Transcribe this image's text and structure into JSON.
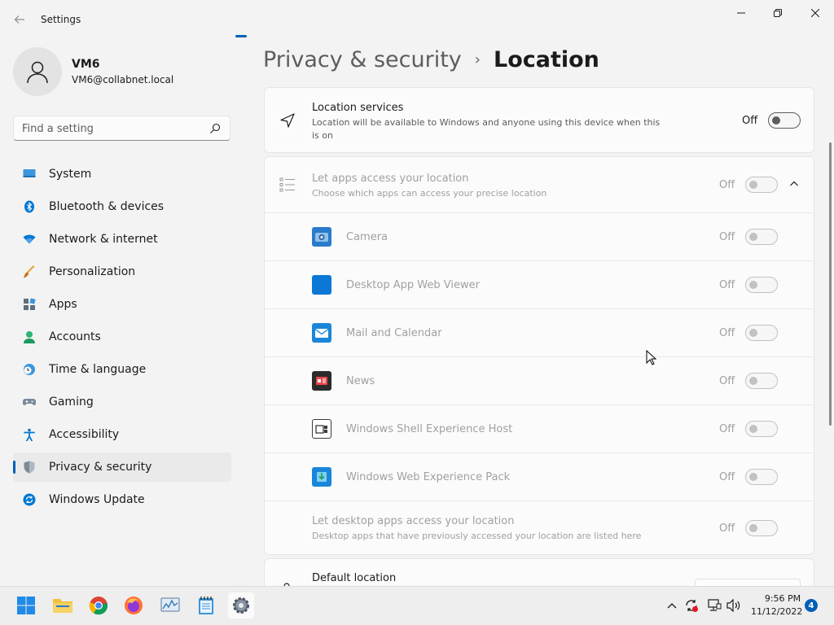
{
  "window": {
    "title": "Settings"
  },
  "user": {
    "name": "VM6",
    "email": "VM6@collabnet.local"
  },
  "search": {
    "placeholder": "Find a setting"
  },
  "nav": {
    "items": [
      {
        "label": "System",
        "icon": "system-icon"
      },
      {
        "label": "Bluetooth & devices",
        "icon": "bluetooth-icon"
      },
      {
        "label": "Network & internet",
        "icon": "network-icon"
      },
      {
        "label": "Personalization",
        "icon": "brush-icon"
      },
      {
        "label": "Apps",
        "icon": "apps-icon"
      },
      {
        "label": "Accounts",
        "icon": "accounts-icon"
      },
      {
        "label": "Time & language",
        "icon": "clock-globe-icon"
      },
      {
        "label": "Gaming",
        "icon": "gamepad-icon"
      },
      {
        "label": "Accessibility",
        "icon": "accessibility-icon"
      },
      {
        "label": "Privacy & security",
        "icon": "shield-icon",
        "active": true
      },
      {
        "label": "Windows Update",
        "icon": "update-icon"
      }
    ]
  },
  "breadcrumb": {
    "parent": "Privacy & security",
    "separator": "›",
    "current": "Location"
  },
  "location_services": {
    "title": "Location services",
    "description": "Location will be available to Windows and anyone using this device when this is on",
    "state": "Off"
  },
  "apps_access": {
    "title": "Let apps access your location",
    "description": "Choose which apps can access your precise location",
    "state": "Off",
    "apps": [
      {
        "name": "Camera",
        "state": "Off",
        "icon": "camera-icon"
      },
      {
        "name": "Desktop App Web Viewer",
        "state": "Off",
        "icon": "web-viewer-icon"
      },
      {
        "name": "Mail and Calendar",
        "state": "Off",
        "icon": "mail-icon"
      },
      {
        "name": "News",
        "state": "Off",
        "icon": "news-icon"
      },
      {
        "name": "Windows Shell Experience Host",
        "state": "Off",
        "icon": "shell-host-icon"
      },
      {
        "name": "Windows Web Experience Pack",
        "state": "Off",
        "icon": "web-experience-icon"
      }
    ],
    "desktop_apps": {
      "title": "Let desktop apps access your location",
      "description": "Desktop apps that have previously accessed your location are listed here",
      "state": "Off"
    }
  },
  "default_location": {
    "title": "Default location"
  },
  "taskbar": {
    "time": "9:56 PM",
    "date": "11/12/2022",
    "notifications": "4"
  },
  "colors": {
    "accent": "#005fb8"
  }
}
